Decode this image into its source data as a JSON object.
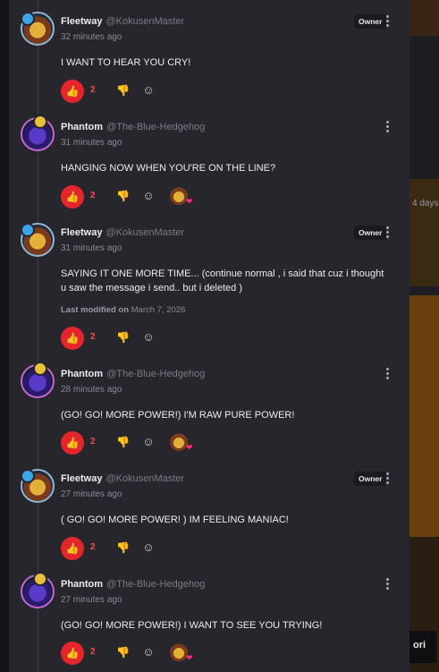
{
  "background": {
    "right_partial_text": "4 days",
    "right_bottom_text": "ori"
  },
  "owner_label": "Owner",
  "modified_label": "Last modified on",
  "comments": [
    {
      "author": "Fleetway",
      "handle": "@KokusenMaster",
      "time": "32 minutes ago",
      "owner": true,
      "text": "I WANT TO HEAR YOU CRY!",
      "likes": "2",
      "has_reactor": false
    },
    {
      "author": "Phantom",
      "handle": "@The-Blue-Hedgehog",
      "time": "31 minutes ago",
      "owner": false,
      "text": "HANGING NOW WHEN YOU'RE ON THE LINE?",
      "likes": "2",
      "has_reactor": true
    },
    {
      "author": "Fleetway",
      "handle": "@KokusenMaster",
      "time": "31 minutes ago",
      "owner": true,
      "text": "SAYING IT ONE MORE TIME... (continue normal , i said that cuz i thought u saw the message i send.. but i deleted )",
      "modified_date": "March 7, 2026",
      "likes": "2",
      "has_reactor": false
    },
    {
      "author": "Phantom",
      "handle": "@The-Blue-Hedgehog",
      "time": "28 minutes ago",
      "owner": false,
      "text": "(GO! GO! MORE POWER!) I'M RAW PURE POWER!",
      "likes": "2",
      "has_reactor": true
    },
    {
      "author": "Fleetway",
      "handle": "@KokusenMaster",
      "time": "27 minutes ago",
      "owner": true,
      "text": "( GO! GO! MORE POWER! ) IM FEELING MANIAC!",
      "likes": "2",
      "has_reactor": false
    },
    {
      "author": "Phantom",
      "handle": "@The-Blue-Hedgehog",
      "time": "27 minutes ago",
      "owner": false,
      "text": "(GO! GO! MORE POWER!) I WANT TO SEE YOU TRYING!",
      "likes": "2",
      "has_reactor": true
    }
  ],
  "icons": {
    "like": "thumbs-up-icon",
    "dislike": "thumbs-down-icon",
    "react": "add-reaction-icon",
    "more": "more-options-icon",
    "reaction_heart": "heart-icon"
  },
  "colors": {
    "like": "#e5252c",
    "like_count": "#ff4a4f",
    "panel": "#26262c",
    "heart": "#ff2e78"
  }
}
